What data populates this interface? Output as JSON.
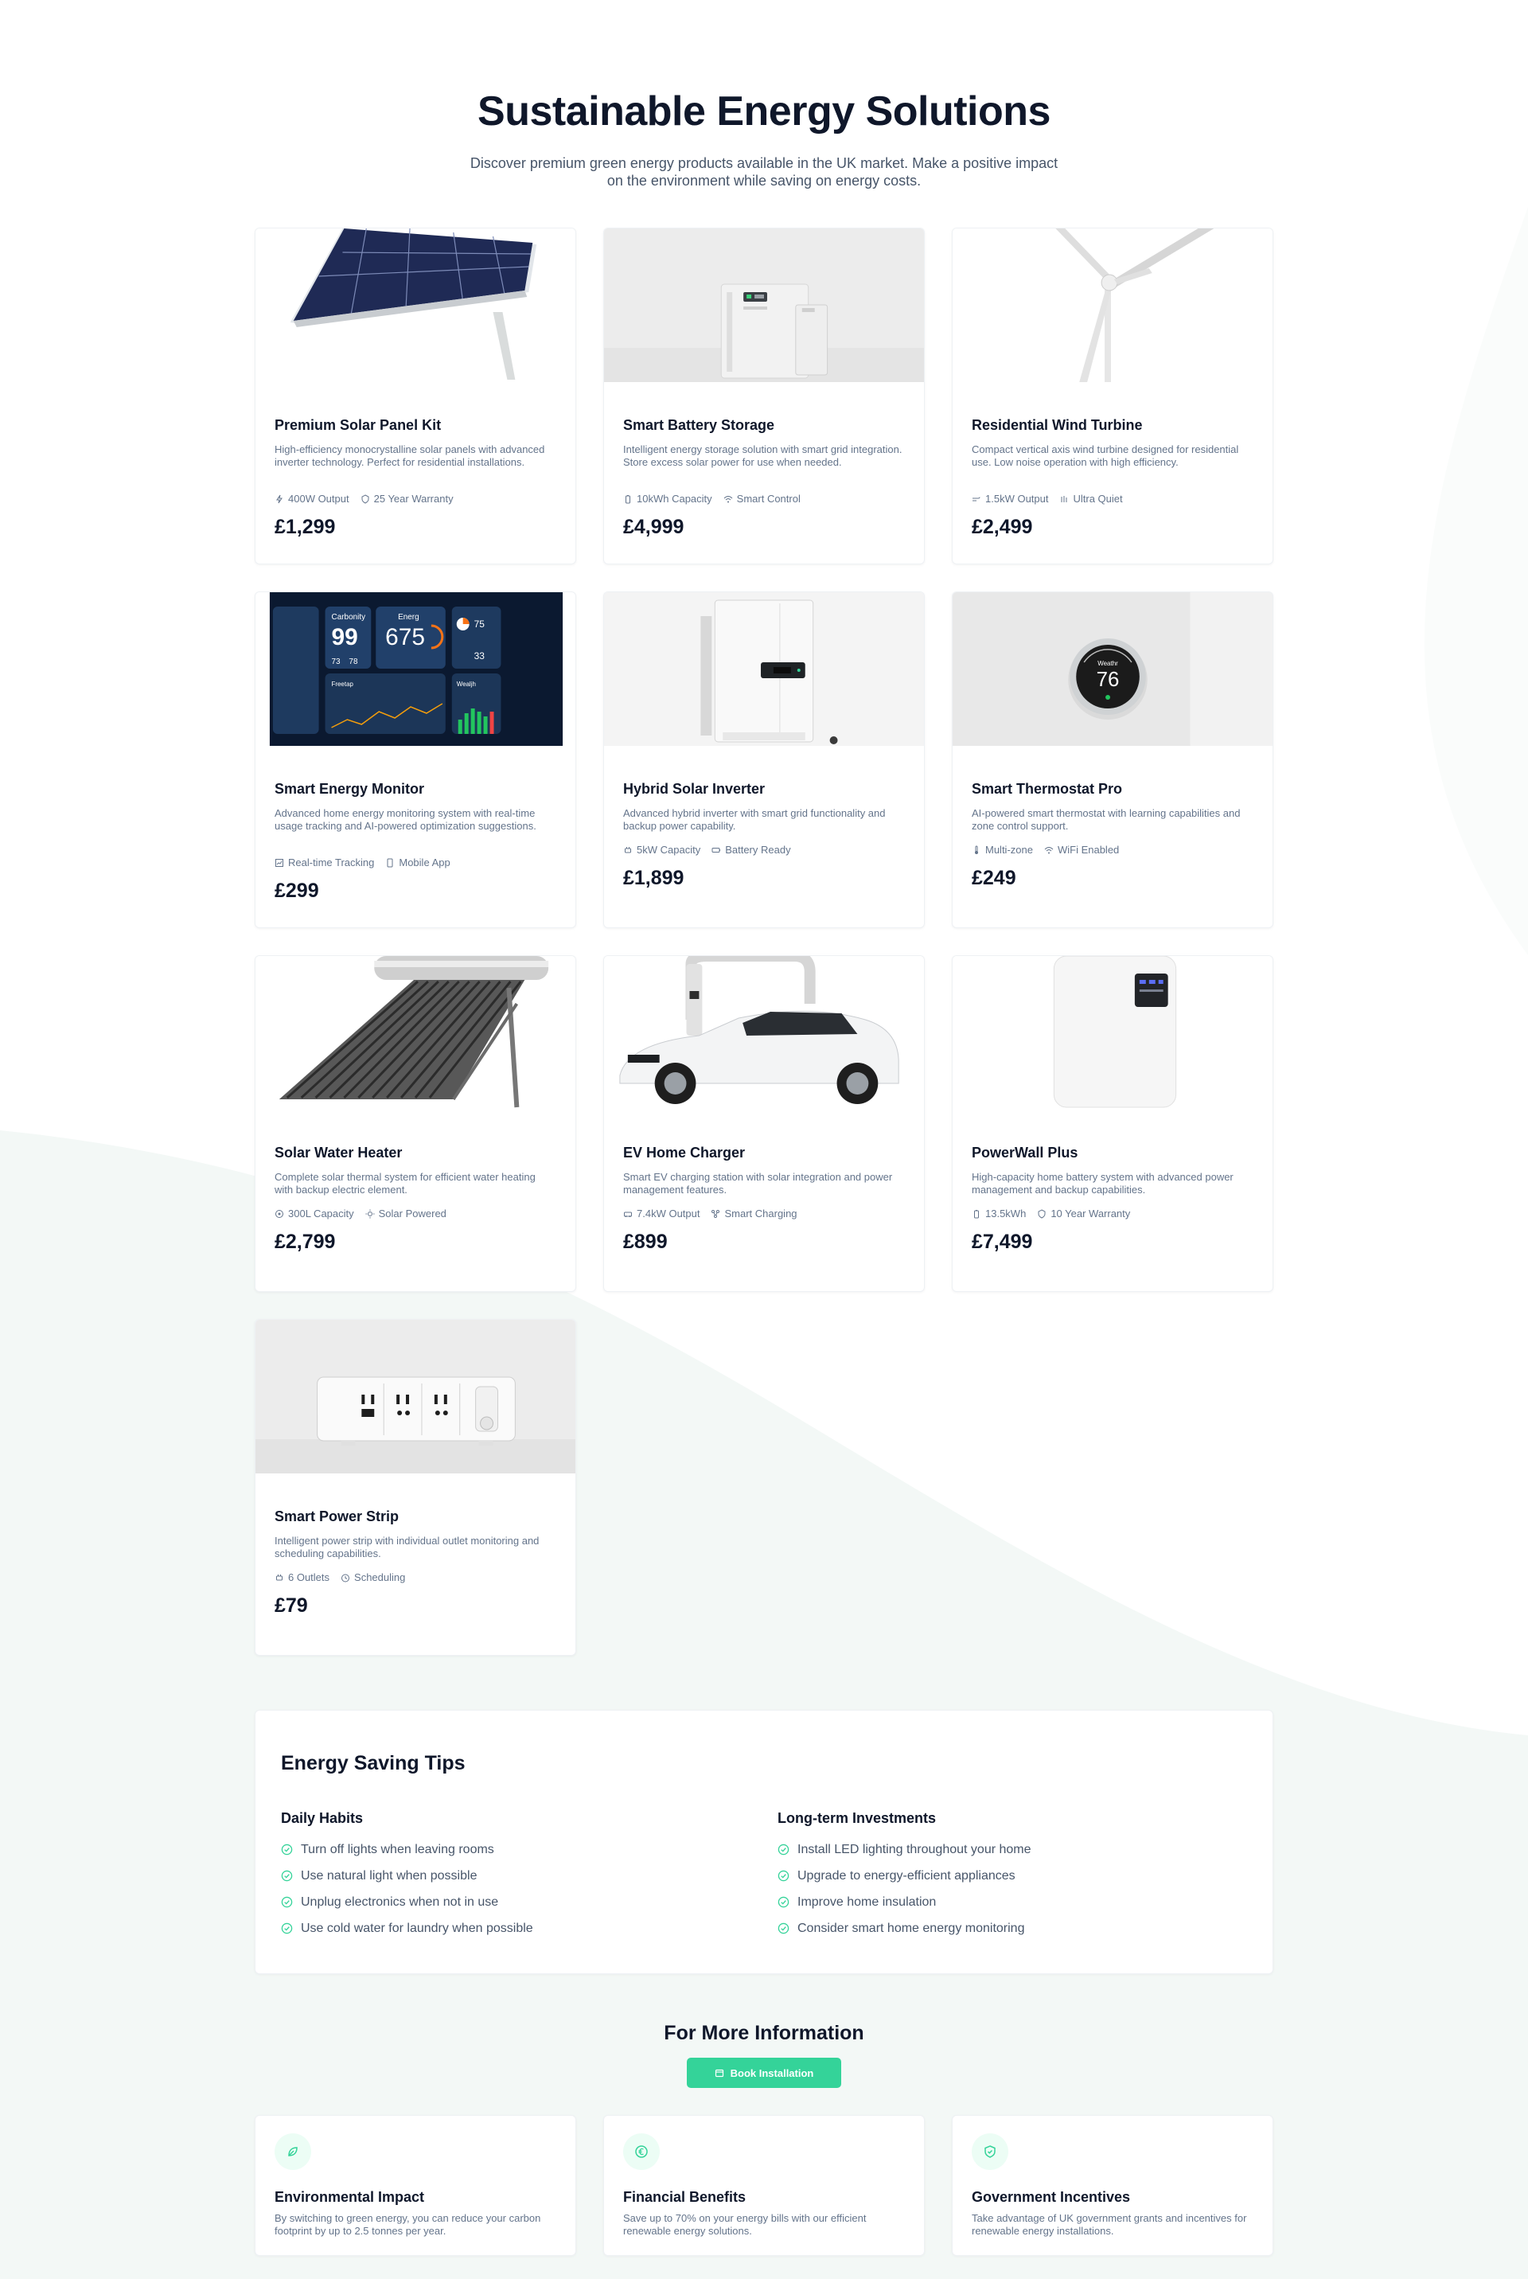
{
  "hero": {
    "title": "Sustainable Energy Solutions",
    "subtitle": "Discover premium green energy products available in the UK market. Make a positive impact on the environment while saving on energy costs."
  },
  "products": [
    {
      "title": "Premium Solar Panel Kit",
      "desc": "High-efficiency monocrystalline solar panels with advanced inverter technology. Perfect for residential installations.",
      "f1": "400W Output",
      "f2": "25 Year Warranty",
      "i1": "bolt-icon",
      "i2": "shield-icon",
      "price": "£1,299"
    },
    {
      "title": "Smart Battery Storage",
      "desc": "Intelligent energy storage solution with smart grid integration. Store excess solar power for use when needed.",
      "f1": "10kWh Capacity",
      "f2": "Smart Control",
      "i1": "battery-icon",
      "i2": "wifi-icon",
      "price": "£4,999"
    },
    {
      "title": "Residential Wind Turbine",
      "desc": "Compact vertical axis wind turbine designed for residential use. Low noise operation with high efficiency.",
      "f1": "1.5kW Output",
      "f2": "Ultra Quiet",
      "i1": "wind-icon",
      "i2": "sound-bars-icon",
      "price": "£2,499"
    },
    {
      "title": "Smart Energy Monitor",
      "desc": "Advanced home energy monitoring system with real-time usage tracking and AI-powered optimization suggestions.",
      "f1": "Real-time Tracking",
      "f2": "Mobile App",
      "i1": "chart-icon",
      "i2": "phone-icon",
      "price": "£299"
    },
    {
      "title": "Hybrid Solar Inverter",
      "desc": "Advanced hybrid inverter with smart grid functionality and backup power capability.",
      "f1": "5kW Capacity",
      "f2": "Battery Ready",
      "i1": "plug-icon",
      "i2": "battery-horizontal-icon",
      "price": "£1,899"
    },
    {
      "title": "Smart Thermostat Pro",
      "desc": "AI-powered smart thermostat with learning capabilities and zone control support.",
      "f1": "Multi-zone",
      "f2": "WiFi Enabled",
      "i1": "thermometer-icon",
      "i2": "wifi-icon",
      "price": "£249"
    },
    {
      "title": "Solar Water Heater",
      "desc": "Complete solar thermal system for efficient water heating with backup electric element.",
      "f1": "300L Capacity",
      "f2": "Solar Powered",
      "i1": "droplet-icon",
      "i2": "sun-icon",
      "price": "£2,799"
    },
    {
      "title": "EV Home Charger",
      "desc": "Smart EV charging station with solar integration and power management features.",
      "f1": "7.4kW Output",
      "f2": "Smart Charging",
      "i1": "car-icon",
      "i2": "network-icon",
      "price": "£899"
    },
    {
      "title": "PowerWall Plus",
      "desc": "High-capacity home battery system with advanced power management and backup capabilities.",
      "f1": "13.5kWh",
      "f2": "10 Year Warranty",
      "i1": "battery-icon",
      "i2": "shield-icon",
      "price": "£7,499"
    },
    {
      "title": "Smart Power Strip",
      "desc": "Intelligent power strip with individual outlet monitoring and scheduling capabilities.",
      "f1": "6 Outlets",
      "f2": "Scheduling",
      "i1": "plug-icon",
      "i2": "clock-icon",
      "price": "£79"
    }
  ],
  "tips": {
    "title": "Energy Saving Tips",
    "daily": {
      "heading": "Daily Habits",
      "items": [
        "Turn off lights when leaving rooms",
        "Use natural light when possible",
        "Unplug electronics when not in use",
        "Use cold water for laundry when possible"
      ]
    },
    "longterm": {
      "heading": "Long-term Investments",
      "items": [
        "Install LED lighting throughout your home",
        "Upgrade to energy-efficient appliances",
        "Improve home insulation",
        "Consider smart home energy monitoring"
      ]
    }
  },
  "more": {
    "title": "For More Information",
    "button": "Book Installation",
    "button_icon": "calendar-icon"
  },
  "info": [
    {
      "title": "Environmental Impact",
      "desc": "By switching to green energy, you can reduce your carbon footprint by up to 2.5 tonnes per year.",
      "icon": "leaf-icon"
    },
    {
      "title": "Financial Benefits",
      "desc": "Save up to 70% on your energy bills with our efficient renewable energy solutions.",
      "icon": "euro-icon"
    },
    {
      "title": "Government Incentives",
      "desc": "Take advantage of UK government grants and incentives for renewable energy installations.",
      "icon": "shield-check-icon"
    }
  ],
  "colors": {
    "accent": "#34d399",
    "text": "#0f172a",
    "muted": "#64748b"
  },
  "media_text": {
    "monitor": {
      "label1": "Carbonity",
      "value1": "99",
      "label2": "Energ",
      "value2": "675",
      "small1": "75",
      "small2": "33",
      "row1": "73",
      "row2": "78",
      "chart_label1": "Freetap",
      "chart_label2": "Wealjh"
    },
    "thermostat": {
      "label": "Weathr",
      "value": "76"
    }
  }
}
